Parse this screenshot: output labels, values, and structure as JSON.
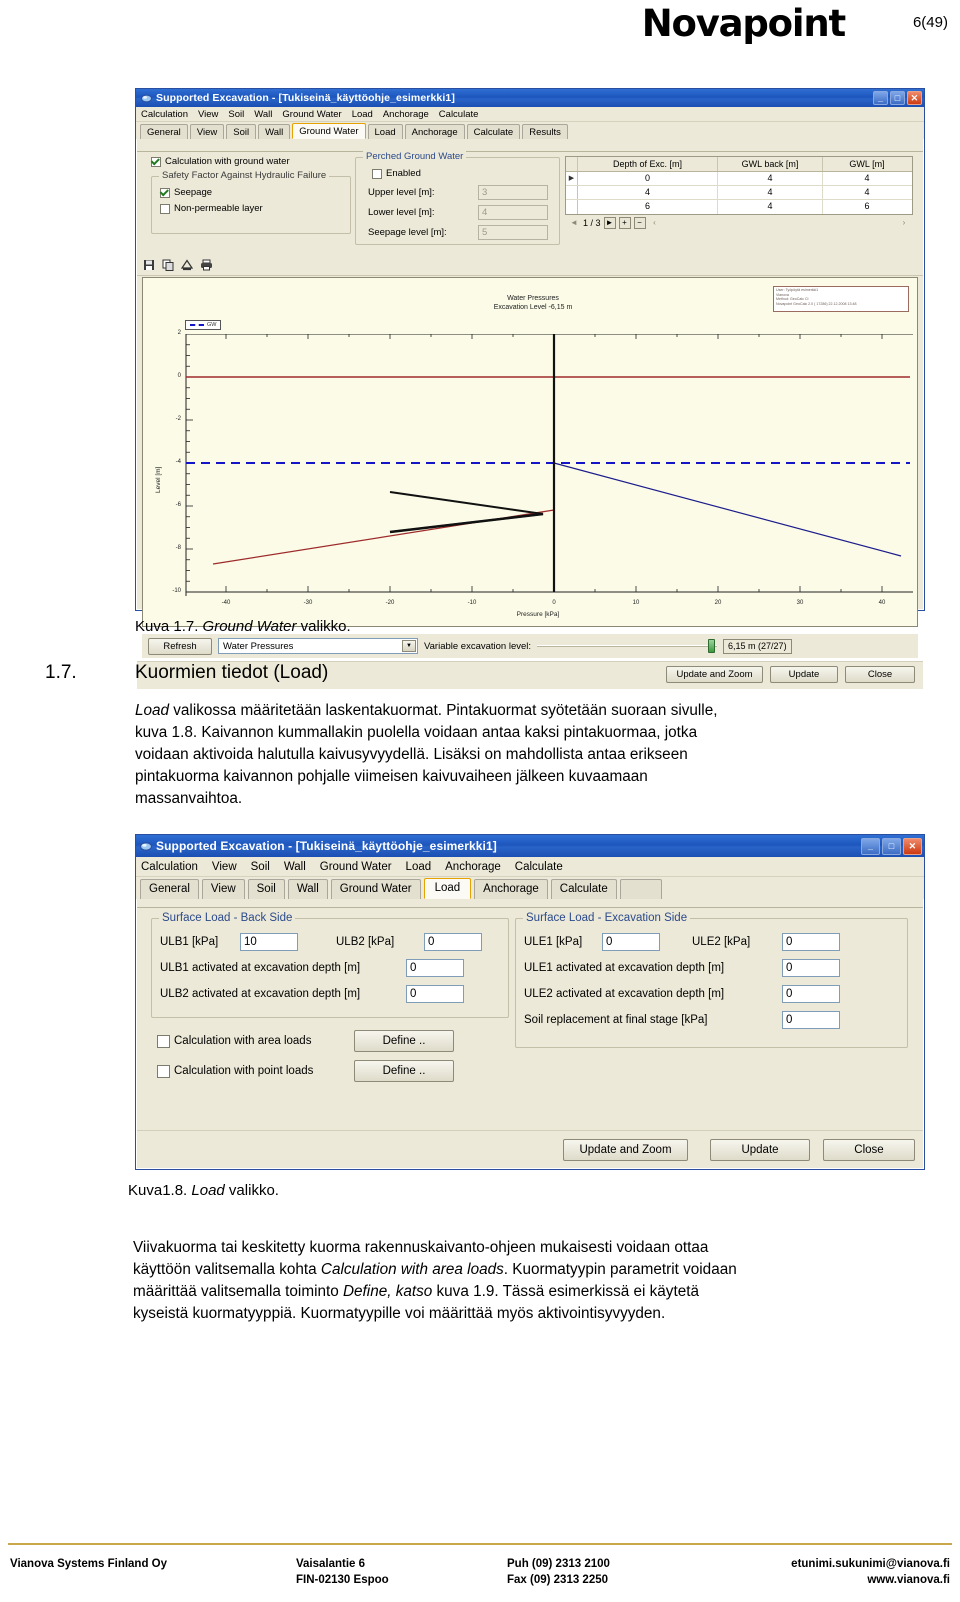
{
  "page": {
    "logo": "Novapoint",
    "page_number": "6(49)"
  },
  "dialog_ground_water": {
    "title": "Supported Excavation - [Tukiseinä_käyttöohje_esimerkki1]",
    "window_buttons": {
      "minimize": "_",
      "maximize": "□",
      "close": "✕"
    },
    "menu": [
      "Calculation",
      "View",
      "Soil",
      "Wall",
      "Ground Water",
      "Load",
      "Anchorage",
      "Calculate"
    ],
    "tabs": [
      "General",
      "View",
      "Soil",
      "Wall",
      "Ground Water",
      "Load",
      "Anchorage",
      "Calculate",
      "Results"
    ],
    "active_tab": "Ground Water",
    "calculation_with_ground_water": {
      "label": "Calculation with ground water",
      "checked": true
    },
    "safety_group": {
      "label": "Safety Factor Against Hydraulic Failure",
      "seepage": {
        "label": "Seepage",
        "checked": true
      },
      "non_permeable": {
        "label": "Non-permeable layer",
        "checked": false
      }
    },
    "perched_group": {
      "label": "Perched Ground Water",
      "enabled": {
        "label": "Enabled",
        "checked": false
      },
      "fields": [
        {
          "label": "Upper level [m]:",
          "value": "3"
        },
        {
          "label": "Lower level [m]:",
          "value": "4"
        },
        {
          "label": "Seepage level [m]:",
          "value": "5"
        }
      ]
    },
    "grid": {
      "columns": [
        "Depth of Exc. [m]",
        "GWL back [m]",
        "GWL [m]"
      ],
      "rows": [
        [
          "0",
          "4",
          "4"
        ],
        [
          "4",
          "4",
          "4"
        ],
        [
          "6",
          "4",
          "6"
        ]
      ],
      "nav": {
        "prev": "◄",
        "position": "1 / 3",
        "next": "►",
        "add": "+",
        "remove": "−",
        "end": "‹"
      }
    },
    "chart_toolbar": [
      "save-icon",
      "copy-icon",
      "export-icon",
      "print-icon"
    ],
    "bottom": {
      "refresh_label": "Refresh",
      "plot_select_value": "Water Pressures",
      "variable_level_label": "Variable excavation level:",
      "level_readout": "6,15 m (27/27)",
      "update_and_zoom": "Update and Zoom",
      "update": "Update",
      "close": "Close"
    },
    "info_box": [
      "User: Työpöytä esimerkki1",
      "Vianova",
      "Method: GeoCalc CI",
      "Novapoint GeoCalc 2.0 ( 17286) 22.12.2008 13:48"
    ]
  },
  "chart_data": {
    "type": "line",
    "title": "Water Pressures",
    "subtitle": "Excavation Level -6,15 m",
    "xlabel": "Pressure [kPa]",
    "ylabel": "Level [m]",
    "xlim": [
      -46,
      46
    ],
    "ylim": [
      -10,
      2
    ],
    "xticks": [
      "-40",
      "-30",
      "-20",
      "-10",
      "0",
      "10",
      "20",
      "30",
      "40"
    ],
    "yticks": [
      "2",
      "0",
      "-2",
      "-4",
      "-6",
      "-8",
      "-10"
    ],
    "grid": false,
    "legend": {
      "position": "top-left",
      "entries": [
        "GW"
      ]
    },
    "series": [
      {
        "name": "Ground level line",
        "color": "#9e2a2a",
        "style": "solid",
        "points": [
          [
            -46,
            0
          ],
          [
            46,
            0
          ]
        ]
      },
      {
        "name": "GW",
        "color": "#1414c8",
        "style": "dashed",
        "points": [
          [
            -46,
            -4
          ],
          [
            46,
            -4
          ]
        ]
      },
      {
        "name": "Active water pressure (back side)",
        "color": "#9e2a2a",
        "style": "solid",
        "points": [
          [
            -44,
            -8.7
          ],
          [
            -20,
            -7.1
          ],
          [
            0,
            -6.15
          ]
        ]
      },
      {
        "name": "Net water pressure wedge",
        "color": "#111111",
        "style": "solid",
        "points": [
          [
            -20,
            -7.1
          ],
          [
            -3,
            -6.2
          ],
          [
            -20,
            -5.3
          ]
        ]
      },
      {
        "name": "Passive water pressure (excavation side)",
        "color": "#1c1c8c",
        "style": "solid",
        "points": [
          [
            0,
            -4.0
          ],
          [
            44,
            -9.0
          ]
        ]
      },
      {
        "name": "Wall",
        "color": "#111111",
        "style": "solid",
        "points": [
          [
            0,
            2
          ],
          [
            0,
            -10
          ]
        ]
      }
    ]
  },
  "caption_17": {
    "prefix": "Kuva 1.7. ",
    "italic": "Ground Water",
    "suffix": " valikko."
  },
  "section": {
    "number": "1.7.",
    "title": "Kuormien tiedot (Load)"
  },
  "paragraph_1": {
    "line1_italic": "Load",
    "line1_rest": " valikossa määritetään laskentakuormat. Pintakuormat syötetään suoraan sivulle,",
    "line2": "kuva 1.8. Kaivannon kummallakin puolella voidaan antaa kaksi pintakuormaa, jotka",
    "line3": "voidaan aktivoida halutulla kaivusyvyydellä. Lisäksi on mahdollista antaa erikseen",
    "line4": "pintakuorma kaivannon pohjalle viimeisen kaivuvaiheen jälkeen kuvaamaan",
    "line5": "massanvaihtoa."
  },
  "dialog_load": {
    "title": "Supported Excavation - [Tukiseinä_käyttöohje_esimerkki1]",
    "window_buttons": {
      "minimize": "_",
      "maximize": "□",
      "close": "✕"
    },
    "menu": [
      "Calculation",
      "View",
      "Soil",
      "Wall",
      "Ground Water",
      "Load",
      "Anchorage",
      "Calculate"
    ],
    "tabs": [
      "General",
      "View",
      "Soil",
      "Wall",
      "Ground Water",
      "Load",
      "Anchorage",
      "Calculate"
    ],
    "active_tab": "Load",
    "back_side": {
      "label": "Surface Load - Back Side",
      "ulb1_label": "ULB1 [kPa]",
      "ulb1_value": "10",
      "ulb2_label": "ULB2 [kPa]",
      "ulb2_value": "0",
      "ulb1_depth_label": "ULB1 activated at excavation depth [m]",
      "ulb1_depth_value": "0",
      "ulb2_depth_label": "ULB2 activated at excavation depth [m]",
      "ulb2_depth_value": "0"
    },
    "excavation_side": {
      "label": "Surface Load - Excavation Side",
      "ule1_label": "ULE1 [kPa]",
      "ule1_value": "0",
      "ule2_label": "ULE2 [kPa]",
      "ule2_value": "0",
      "ule1_depth_label": "ULE1 activated at excavation depth [m]",
      "ule1_depth_value": "0",
      "ule2_depth_label": "ULE2 activated at excavation depth [m]",
      "ule2_depth_value": "0",
      "soil_replacement_label": "Soil replacement at final stage [kPa]",
      "soil_replacement_value": "0"
    },
    "area_loads": {
      "label": "Calculation with area loads",
      "checked": false,
      "button": "Define .."
    },
    "point_loads": {
      "label": "Calculation with point loads",
      "checked": false,
      "button": "Define .."
    },
    "bottom": {
      "update_and_zoom": "Update and Zoom",
      "update": "Update",
      "close": "Close"
    }
  },
  "caption_18": {
    "prefix": "Kuva1.8. ",
    "italic": "Load",
    "suffix": " valikko."
  },
  "paragraph_2": {
    "line1": "Viivakuorma tai keskitetty kuorma rakennuskaivanto-ohjeen mukaisesti voidaan ottaa",
    "line2_pre": "käyttöön valitsemalla kohta ",
    "line2_italic": "Calculation with area loads",
    "line2_post": ". Kuormatyypin parametrit voidaan",
    "line3_pre": "määrittää valitsemalla toiminto ",
    "line3_italic": "Define, katso",
    "line3_post": " kuva 1.9. Tässä esimerkissä ei käytetä",
    "line4": "kyseistä kuormatyyppiä. Kuormatyypille voi määrittää myös aktivointisyvyyden."
  },
  "footer": {
    "company": "Vianova Systems Finland Oy",
    "address_line1": "Vaisalantie 6",
    "address_line2": "FIN-02130 Espoo",
    "phone_line1": "Puh  (09) 2313 2100",
    "phone_line2": "Fax  (09) 2313 2250",
    "web_line1": "etunimi.sukunimi@vianova.fi",
    "web_line2": "www.vianova.fi"
  }
}
